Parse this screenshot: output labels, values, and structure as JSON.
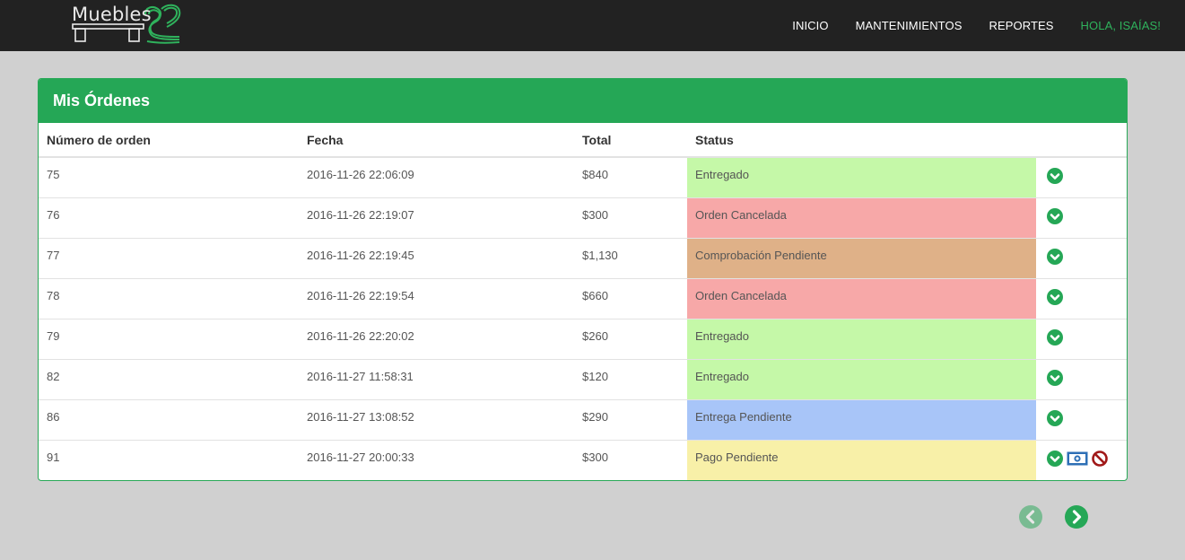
{
  "brand": {
    "name": "Muebles"
  },
  "nav": {
    "items": [
      "INICIO",
      "MANTENIMIENTOS",
      "REPORTES"
    ],
    "user": "HOLA, ISAÍAS!"
  },
  "panel": {
    "title": "Mis Órdenes"
  },
  "table": {
    "headers": [
      "Número de orden",
      "Fecha",
      "Total",
      "Status"
    ],
    "rows": [
      {
        "id": "75",
        "date": "2016-11-26 22:06:09",
        "total": "$840",
        "status": "Entregado",
        "color": "#c5f8a8",
        "extra": false
      },
      {
        "id": "76",
        "date": "2016-11-26 22:19:07",
        "total": "$300",
        "status": "Orden Cancelada",
        "color": "#f7a8a8",
        "extra": false
      },
      {
        "id": "77",
        "date": "2016-11-26 22:19:45",
        "total": "$1,130",
        "status": "Comprobación Pendiente",
        "color": "#dfb188",
        "extra": false
      },
      {
        "id": "78",
        "date": "2016-11-26 22:19:54",
        "total": "$660",
        "status": "Orden Cancelada",
        "color": "#f7a8a8",
        "extra": false
      },
      {
        "id": "79",
        "date": "2016-11-26 22:20:02",
        "total": "$260",
        "status": "Entregado",
        "color": "#c5f8a8",
        "extra": false
      },
      {
        "id": "82",
        "date": "2016-11-27 11:58:31",
        "total": "$120",
        "status": "Entregado",
        "color": "#c5f8a8",
        "extra": false
      },
      {
        "id": "86",
        "date": "2016-11-27 13:08:52",
        "total": "$290",
        "status": "Entrega Pendiente",
        "color": "#a8c5f8",
        "extra": false
      },
      {
        "id": "91",
        "date": "2016-11-27 20:00:33",
        "total": "$300",
        "status": "Pago Pendiente",
        "color": "#f8f0a8",
        "extra": true
      }
    ]
  },
  "icons": {
    "details": "chevron-down-circle-icon",
    "pay": "money-bill-icon",
    "cancel": "ban-icon",
    "prev": "chevron-left-circle-icon",
    "next": "chevron-right-circle-icon"
  },
  "colors": {
    "navbar": "#222222",
    "accent": "#25a756",
    "user_link": "#2fb25c",
    "background": "#d0d0d0"
  }
}
